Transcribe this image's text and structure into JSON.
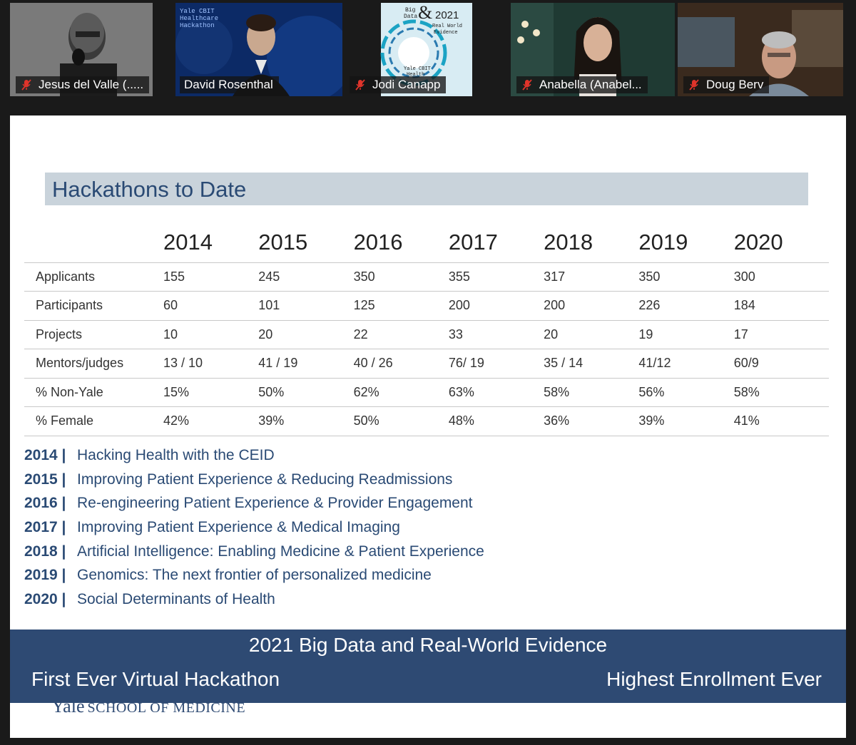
{
  "participants": [
    {
      "name": "Jesus del Valle (.....",
      "muted": true,
      "active": false
    },
    {
      "name": "David Rosenthal",
      "muted": false,
      "active": true,
      "video_text": "Yale CBIT Healthcare Hackathon"
    },
    {
      "name": "Jodi Canapp",
      "muted": true,
      "active": false,
      "video_text": [
        "Big Data",
        "&",
        "2021",
        "Real World Evidence",
        "Yale CBIT Health"
      ]
    },
    {
      "name": "Anabella (Anabel...",
      "muted": true,
      "active": false
    },
    {
      "name": "Doug Berv",
      "muted": true,
      "active": false
    }
  ],
  "slide": {
    "title": "Hackathons to Date",
    "table": {
      "years": [
        "2014",
        "2015",
        "2016",
        "2017",
        "2018",
        "2019",
        "2020"
      ],
      "rows": [
        {
          "label": "Applicants",
          "values": [
            "155",
            "245",
            "350",
            "355",
            "317",
            "350",
            "300"
          ]
        },
        {
          "label": "Participants",
          "values": [
            "60",
            "101",
            "125",
            "200",
            "200",
            "226",
            "184"
          ]
        },
        {
          "label": "Projects",
          "values": [
            "10",
            "20",
            "22",
            "33",
            "20",
            "19",
            "17"
          ]
        },
        {
          "label": "Mentors/judges",
          "values": [
            "13 / 10",
            "41 / 19",
            "40 / 26",
            "76/ 19",
            "35 / 14",
            "41/12",
            "60/9"
          ]
        },
        {
          "label": "% Non-Yale",
          "values": [
            "15%",
            "50%",
            "62%",
            "63%",
            "58%",
            "56%",
            "58%"
          ]
        },
        {
          "label": "% Female",
          "values": [
            "42%",
            "39%",
            "50%",
            "48%",
            "36%",
            "39%",
            "41%"
          ]
        }
      ]
    },
    "themes": [
      {
        "year": "2014 |",
        "text": "Hacking Health with the CEID"
      },
      {
        "year": "2015 |",
        "text": "Improving Patient Experience & Reducing Readmissions"
      },
      {
        "year": "2016 |",
        "text": "Re-engineering Patient Experience & Provider Engagement"
      },
      {
        "year": "2017 |",
        "text": "Improving Patient Experience & Medical Imaging"
      },
      {
        "year": "2018 |",
        "text": "Artificial Intelligence: Enabling Medicine & Patient Experience"
      },
      {
        "year": "2019 |",
        "text": "Genomics: The next frontier of personalized medicine"
      },
      {
        "year": "2020 |",
        "text": "Social Determinants of Health"
      }
    ],
    "footer": {
      "headline": "2021 Big Data and Real-World Evidence",
      "left": "First Ever Virtual Hackathon",
      "right": "Highest Enrollment Ever"
    },
    "logo": {
      "yale": "Yale",
      "school": "SCHOOL OF MEDICINE"
    }
  },
  "colors": {
    "accent": "#2e4a73",
    "title_bar": "#c9d3db",
    "active_border": "#d9d46a",
    "muted_icon": "#e0342b"
  }
}
